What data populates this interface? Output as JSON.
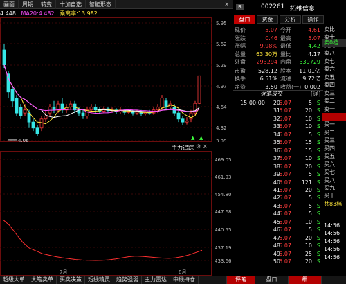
{
  "toolbar": {
    "items": [
      "画面",
      "周期",
      "转变",
      "十加自选",
      "智能形态"
    ],
    "close_label": "✕"
  },
  "ma_line": {
    "ma1": "4.448",
    "ma2": "MA20:4.482",
    "ma3": "乘离率:13.982"
  },
  "price_axis": [
    "5.95",
    "5.62",
    "5.29",
    "4.97",
    "4.64",
    "4.32",
    "3.99"
  ],
  "low_marker": "4.06",
  "indicator": {
    "title": "主力追踪",
    "axis": [
      "469.05",
      "461.93",
      "454.80",
      "447.68",
      "440.55",
      "437.19",
      "433.66"
    ]
  },
  "date_labels": [
    "7月",
    "8月"
  ],
  "bottom_tabs": [
    {
      "label": "超级大单",
      "active": false
    },
    {
      "label": "大笔卖单",
      "active": false
    },
    {
      "label": "买卖决策",
      "active": false
    },
    {
      "label": "短线精灵",
      "active": false
    },
    {
      "label": "趋势强弱",
      "active": false
    },
    {
      "label": "主力雷达",
      "active": false
    },
    {
      "label": "中线持仓",
      "active": false
    },
    {
      "label": "",
      "active": false
    },
    {
      "label": "评笔",
      "active": true
    },
    {
      "label": "盘口",
      "active": false
    },
    {
      "label": "细",
      "active": true
    }
  ],
  "stock": {
    "badge": "R",
    "code": "002261",
    "name": "拓维信息"
  },
  "tabs": [
    {
      "label": "盘口",
      "active": true
    },
    {
      "label": "资金",
      "active": false
    },
    {
      "label": "分析",
      "active": false
    },
    {
      "label": "操作",
      "active": false
    }
  ],
  "quote_rows": [
    {
      "l1": "现价",
      "v1": "5.07",
      "c1": "red",
      "l2": "今开",
      "v2": "4.61",
      "c2": "red"
    },
    {
      "l1": "涨跌",
      "v1": "0.46",
      "c1": "red",
      "l2": "最高",
      "v2": "5.07",
      "c2": "red"
    },
    {
      "l1": "涨幅",
      "v1": "9.98%",
      "c1": "red",
      "l2": "最低",
      "v2": "4.42",
      "c2": "green"
    },
    {
      "l1": "总量",
      "v1": "63.30万",
      "c1": "yellow",
      "l2": "量比",
      "v2": "4.17",
      "c2": "white"
    },
    {
      "l1": "外盘",
      "v1": "293294",
      "c1": "red",
      "l2": "内盘",
      "v2": "339729",
      "c2": "green"
    },
    {
      "l1": "市盈",
      "v1": "528.12",
      "c1": "white",
      "l2": "股本",
      "v2": "11.01亿",
      "c2": "white"
    },
    {
      "l1": "换手",
      "v1": "6.51%",
      "c1": "white",
      "l2": "流通",
      "v2": "9.72亿",
      "c2": "white"
    },
    {
      "l1": "净资",
      "v1": "3.50",
      "c1": "white",
      "l2": "收益(一)",
      "v2": "0.002",
      "c2": "white"
    }
  ],
  "trades_header": {
    "title": "逐笔成交",
    "detail": "[详]"
  },
  "trades": [
    {
      "time": "15:00:00",
      "vol": "20",
      "price": "5.07",
      "qty": "5",
      "side": "S"
    },
    {
      "time": "",
      "vol": "31",
      "price": "5.07",
      "qty": "20",
      "side": "S"
    },
    {
      "time": "",
      "vol": "32",
      "price": "5.07",
      "qty": "10",
      "side": "S"
    },
    {
      "time": "",
      "vol": "33",
      "price": "5.07",
      "qty": "10",
      "side": "S"
    },
    {
      "time": "",
      "vol": "34",
      "price": "5.07",
      "qty": "5",
      "side": "S"
    },
    {
      "time": "",
      "vol": "35",
      "price": "5.07",
      "qty": "15",
      "side": "S"
    },
    {
      "time": "",
      "vol": "36",
      "price": "5.07",
      "qty": "15",
      "side": "S"
    },
    {
      "time": "",
      "vol": "37",
      "price": "5.07",
      "qty": "10",
      "side": "S"
    },
    {
      "time": "",
      "vol": "38",
      "price": "5.07",
      "qty": "20",
      "side": "S"
    },
    {
      "time": "",
      "vol": "39",
      "price": "5.07",
      "qty": "5",
      "side": "S"
    },
    {
      "time": "",
      "vol": "40",
      "price": "5.07",
      "qty": "121",
      "side": "S"
    },
    {
      "time": "",
      "vol": "41",
      "price": "5.07",
      "qty": "20",
      "side": "S"
    },
    {
      "time": "",
      "vol": "42",
      "price": "5.07",
      "qty": "5",
      "side": "S"
    },
    {
      "time": "",
      "vol": "43",
      "price": "5.07",
      "qty": "5",
      "side": "S"
    },
    {
      "time": "",
      "vol": "44",
      "price": "5.07",
      "qty": "5",
      "side": "S"
    },
    {
      "time": "",
      "vol": "45",
      "price": "5.07",
      "qty": "10",
      "side": "S"
    },
    {
      "time": "",
      "vol": "46",
      "price": "5.07",
      "qty": "5",
      "side": "S"
    },
    {
      "time": "",
      "vol": "47",
      "price": "5.07",
      "qty": "20",
      "side": "S"
    },
    {
      "time": "",
      "vol": "48",
      "price": "5.07",
      "qty": "10",
      "side": "S"
    },
    {
      "time": "",
      "vol": "49",
      "price": "5.07",
      "qty": "25",
      "side": "S"
    },
    {
      "time": "",
      "vol": "50",
      "price": "5.07",
      "qty": "20",
      "side": "S"
    }
  ],
  "side_slots": [
    "卖比",
    "卖十",
    "卖九",
    "卖八",
    "卖七",
    "卖六",
    "卖五",
    "卖四",
    "卖三",
    "卖二",
    "卖一",
    "",
    "买一",
    "买二",
    "买三",
    "买四",
    "买五",
    "买六",
    "买七",
    "买八",
    "买九",
    "买十",
    "共83档",
    "",
    "14:56",
    "14:56",
    "14:56",
    "14:56",
    "14:56"
  ],
  "side_slot_top": "卖比",
  "side_slot_yellow": "共83档",
  "side_slot_hi": "卖0档",
  "chart_colors": {
    "up": "#ff3b3b",
    "down": "#36e6e6",
    "ma_short": "#ffe63b",
    "ma_long": "#ff4dff",
    "indicator": "#ff3030"
  }
}
